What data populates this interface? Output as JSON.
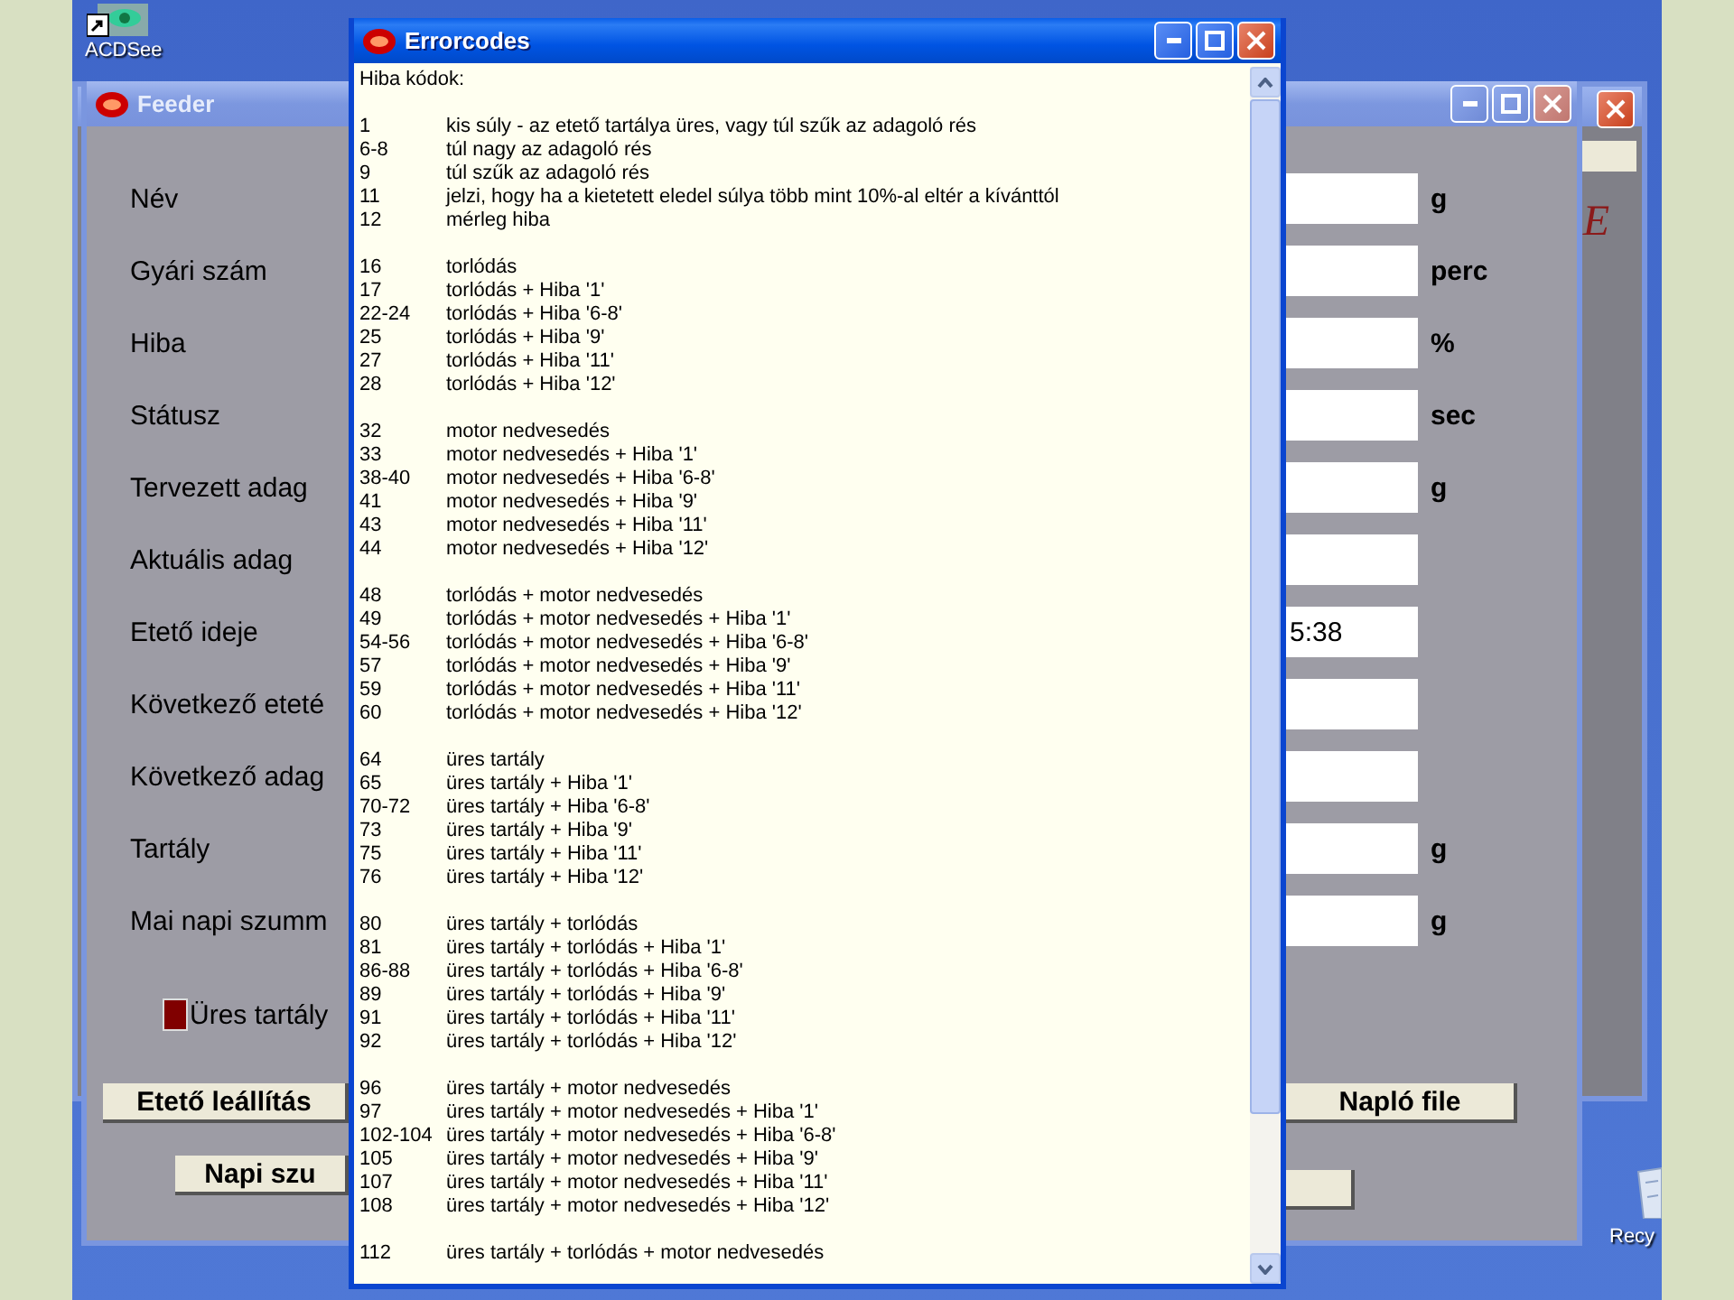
{
  "desktop": {
    "icons": [
      {
        "label": "ACDSee"
      },
      {
        "label": "Recy"
      }
    ]
  },
  "back_window": {
    "logo_text": "E"
  },
  "feeder": {
    "title": "Feeder",
    "fields": [
      {
        "label": "Név",
        "unit": "g"
      },
      {
        "label": "Gyári szám",
        "unit": "perc"
      },
      {
        "label": "Hiba",
        "unit": "%"
      },
      {
        "label": "Státusz",
        "unit": "sec"
      },
      {
        "label": "Tervezett adag",
        "unit": "g"
      },
      {
        "label": "Aktuális adag"
      },
      {
        "label": "Etető ideje",
        "value": "5:38"
      },
      {
        "label": "Következő eteté"
      },
      {
        "label": "Következő adag"
      },
      {
        "label": "Tartály",
        "unit": "g"
      },
      {
        "label": "Mai napi szumm",
        "unit": "g"
      }
    ],
    "indicator": {
      "label": "Üres tartály",
      "on": true
    },
    "buttons": [
      "Etető leállítás",
      "Napló file",
      "Napi szu"
    ]
  },
  "errorcodes": {
    "title": "Errorcodes",
    "heading": "Hiba kódok:",
    "groups": [
      [
        {
          "code": "1",
          "text": "kis súly  - az etető tartálya üres, vagy túl szűk az adagoló rés"
        },
        {
          "code": "6-8",
          "text": "túl nagy az adagoló rés"
        },
        {
          "code": "9",
          "text": "túl szűk az adagoló rés"
        },
        {
          "code": "11",
          "text": "jelzi, hogy ha a kietetett eledel súlya több mint 10%-al eltér a kívánttól"
        },
        {
          "code": "12",
          "text": "mérleg hiba"
        }
      ],
      [
        {
          "code": "16",
          "text": "torlódás"
        },
        {
          "code": "17",
          "text": "torlódás + Hiba '1'"
        },
        {
          "code": "22-24",
          "text": "torlódás + Hiba '6-8'"
        },
        {
          "code": "25",
          "text": "torlódás + Hiba '9'"
        },
        {
          "code": "27",
          "text": "torlódás + Hiba '11'"
        },
        {
          "code": "28",
          "text": "torlódás + Hiba '12'"
        }
      ],
      [
        {
          "code": "32",
          "text": "motor nedvesedés"
        },
        {
          "code": "33",
          "text": "motor nedvesedés + Hiba '1'"
        },
        {
          "code": "38-40",
          "text": "motor nedvesedés + Hiba '6-8'"
        },
        {
          "code": "41",
          "text": "motor nedvesedés + Hiba '9'"
        },
        {
          "code": "43",
          "text": "motor nedvesedés + Hiba '11'"
        },
        {
          "code": "44",
          "text": "motor nedvesedés + Hiba '12'"
        }
      ],
      [
        {
          "code": "48",
          "text": "torlódás + motor nedvesedés"
        },
        {
          "code": "49",
          "text": "torlódás + motor nedvesedés + Hiba '1'"
        },
        {
          "code": "54-56",
          "text": "torlódás + motor nedvesedés + Hiba '6-8'"
        },
        {
          "code": "57",
          "text": "torlódás + motor nedvesedés + Hiba '9'"
        },
        {
          "code": "59",
          "text": "torlódás + motor nedvesedés + Hiba '11'"
        },
        {
          "code": "60",
          "text": "torlódás + motor nedvesedés + Hiba '12'"
        }
      ],
      [
        {
          "code": "64",
          "text": "üres tartály"
        },
        {
          "code": "65",
          "text": "üres tartály + Hiba '1'"
        },
        {
          "code": "70-72",
          "text": "üres tartály + Hiba '6-8'"
        },
        {
          "code": "73",
          "text": "üres tartály + Hiba '9'"
        },
        {
          "code": "75",
          "text": "üres tartály + Hiba '11'"
        },
        {
          "code": "76",
          "text": "üres tartály + Hiba '12'"
        }
      ],
      [
        {
          "code": "80",
          "text": "üres tartály + torlódás"
        },
        {
          "code": "81",
          "text": "üres tartály + torlódás + Hiba '1'"
        },
        {
          "code": "86-88",
          "text": "üres tartály + torlódás + Hiba '6-8'"
        },
        {
          "code": "89",
          "text": "üres tartály + torlódás + Hiba '9'"
        },
        {
          "code": "91",
          "text": "üres tartály + torlódás + Hiba '11'"
        },
        {
          "code": "92",
          "text": "üres tartály + torlódás + Hiba '12'"
        }
      ],
      [
        {
          "code": "96",
          "text": "üres tartály + motor nedvesedés"
        },
        {
          "code": "97",
          "text": "üres tartály + motor nedvesedés + Hiba '1'"
        },
        {
          "code": "102-104",
          "text": "üres tartály + motor nedvesedés + Hiba '6-8'"
        },
        {
          "code": "105",
          "text": "üres tartály + motor nedvesedés + Hiba '9'"
        },
        {
          "code": "107",
          "text": "üres tartály + motor nedvesedés + Hiba '11'"
        },
        {
          "code": "108",
          "text": "üres tartály + motor nedvesedés + Hiba '12'"
        }
      ],
      [
        {
          "code": "112",
          "text": "üres tartály + torlódás + motor nedvesedés"
        }
      ]
    ]
  }
}
